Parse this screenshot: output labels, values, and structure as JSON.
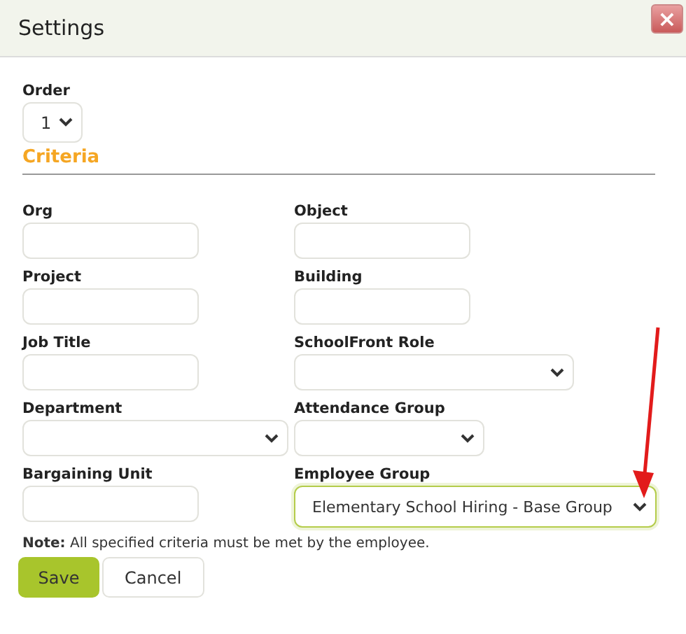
{
  "window": {
    "title": "Settings",
    "close": "×"
  },
  "order": {
    "label": "Order",
    "value": "1"
  },
  "section": {
    "title": "Criteria"
  },
  "fields": [
    {
      "label": "Org",
      "kind": "text",
      "focused": false
    },
    {
      "label": "Object",
      "kind": "text",
      "focused": false
    },
    {
      "label": "Project",
      "kind": "text",
      "focused": false
    },
    {
      "label": "Building",
      "kind": "text",
      "focused": false
    },
    {
      "label": "Job Title",
      "kind": "text",
      "focused": false
    },
    {
      "label": "SchoolFront Role",
      "kind": "select",
      "focused": false
    },
    {
      "label": "Department",
      "kind": "select",
      "focused": false
    },
    {
      "label": "Attendance Group",
      "kind": "select",
      "focused": false
    },
    {
      "label": "Bargaining Unit",
      "kind": "text",
      "focused": false
    },
    {
      "label": "Employee Group",
      "kind": "select",
      "value": "Elementary School Hiring - Base Group",
      "focused": true
    }
  ],
  "note": "**Note:** All specified criteria must be met by the employee.",
  "buttons": [
    {
      "label": "Save",
      "kind": "primary"
    },
    {
      "label": "Cancel",
      "kind": "secondary"
    }
  ],
  "annotation": {
    "kind": "arrow"
  }
}
